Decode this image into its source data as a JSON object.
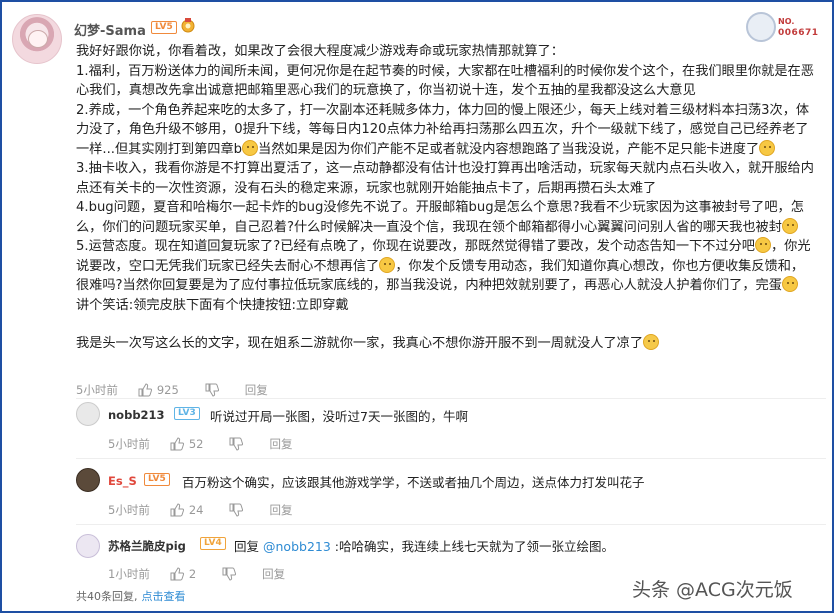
{
  "post": {
    "username": "幻梦-Sama",
    "level": "LV5",
    "medal": "NO.",
    "medal_number": "006671",
    "lines": [
      "我好好跟你说，你看着改，如果改了会很大程度减少游戏寿命或玩家热情那就算了：",
      "1.福利，百万粉送体力的闻所未闻，更何况你是在起节奏的时候，大家都在吐槽福利的时候你发个这个，在我们眼里你就是在恶心我们，真想改先拿出诚意把邮箱里恶心我们的玩意换了，你当初说十连，发个五抽的星我都没这么大意见",
      "2.养成，一个角色养起来吃的太多了，打一次副本还耗贼多体力，体力回的慢上限还少，每天上线对着三级材料本扫荡3次，体力没了，角色升级不够用，0提升下线，等每日内120点体力补给再扫荡那么四五次，升个一级就下线了，感觉自己已经养老了一样...但其实刚打到第四章b",
      "当然如果是因为你们产能不足或者就没内容想跑路了当我没说，产能不足只能卡进度了",
      "3.抽卡收入，我看你游是不打算出夏活了，这一点动静都没有估计也没打算再出啥活动，玩家每天就内点石头收入，就开服给内点还有关卡的一次性资源，没有石头的稳定来源，玩家也就刚开始能抽点卡了，后期再攒石头太难了",
      "4.bug问题，夏音和哈梅尔一起卡炸的bug没修先不说了。开服邮箱bug是怎么个意思?我看不少玩家因为这事被封号了吧，怎么，你们的问题玩家买单，自己忍着?什么时候解决一直没个信，我现在领个邮箱都得小心翼翼问问别人省的哪天我也被封",
      "5.运营态度。现在知道回复玩家了?已经有点晚了，你现在说要改，那既然觉得错了要改，发个动态告知一下不过分吧",
      "，你光说要改，空口无凭我们玩家已经失去耐心不想再信了",
      "，你发个反馈专用动态，我们知道你真心想改，你也方便收集反馈和，很难吗?当然你回复要是为了应付事拉低玩家底线的，那当我没说，内种把效就别要了，再恶心人就没人护着你们了，完蛋",
      "讲个笑话:领完皮肤下面有个快捷按钮:立即穿戴",
      "我是头一次写这么长的文字，现在姐系二游就你一家，我真心不想你游开服不到一周就没人了凉了"
    ],
    "time": "5小时前",
    "likes": "925",
    "reply": "回复"
  },
  "replies": [
    {
      "username": "nobb213",
      "level": "LV3",
      "text": "听说过开局一张图，没听过7天一张图的，牛啊",
      "time": "5小时前",
      "likes": "52",
      "reply": "回复"
    },
    {
      "username": "Es_S",
      "level": "LV5",
      "text": "百万粉这个确实，应该跟其他游戏学学，不送或者抽几个周边，送点体力打发叫花子",
      "time": "5小时前",
      "likes": "24",
      "reply": "回复"
    },
    {
      "username": "苏格兰脆皮pig",
      "level": "LV4",
      "prefix": "回复",
      "mention": "@nobb213",
      "text": ":哈哈确实，我连续上线七天就为了领一张立绘图。",
      "time": "1小时前",
      "likes": "2",
      "reply": "回复"
    }
  ],
  "footer": {
    "total": "共40条回复,",
    "link": "点击查看"
  },
  "watermark": "头条 @ACG次元饭",
  "colors": {
    "accent": "#2e8bd3",
    "level": "#f08a3c",
    "name_red": "#e0483c"
  }
}
